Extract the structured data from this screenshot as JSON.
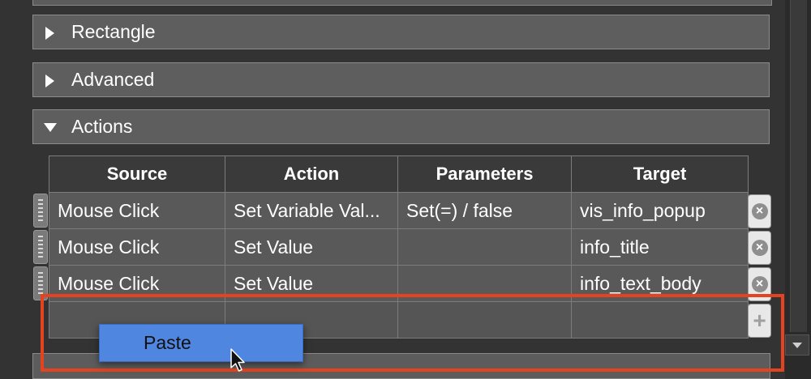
{
  "sections": [
    {
      "label": "Rectangle",
      "expanded": false
    },
    {
      "label": "Advanced",
      "expanded": false
    },
    {
      "label": "Actions",
      "expanded": true
    }
  ],
  "actions_table": {
    "columns": [
      "Source",
      "Action",
      "Parameters",
      "Target"
    ],
    "rows": [
      {
        "source": "Mouse Click",
        "action": "Set Variable Val...",
        "parameters": "Set(=) / false",
        "target": "vis_info_popup"
      },
      {
        "source": "Mouse Click",
        "action": "Set Value",
        "parameters": "",
        "target": "info_title"
      },
      {
        "source": "Mouse Click",
        "action": "Set Value",
        "parameters": "",
        "target": "info_text_body"
      }
    ],
    "add_button": "+",
    "delete_button": "×"
  },
  "context_menu": {
    "items": [
      "Paste"
    ]
  },
  "colors": {
    "background": "#333333",
    "section_bar": "#5e5e5e",
    "header": "#3a3a3a",
    "menu_highlight": "#4f86e0",
    "annotation": "#e5421f"
  },
  "icons": {
    "collapsed": "triangle-right-icon",
    "expanded": "triangle-down-icon",
    "delete": "delete-row-icon",
    "add": "plus-icon",
    "drag": "drag-grip-icon"
  }
}
